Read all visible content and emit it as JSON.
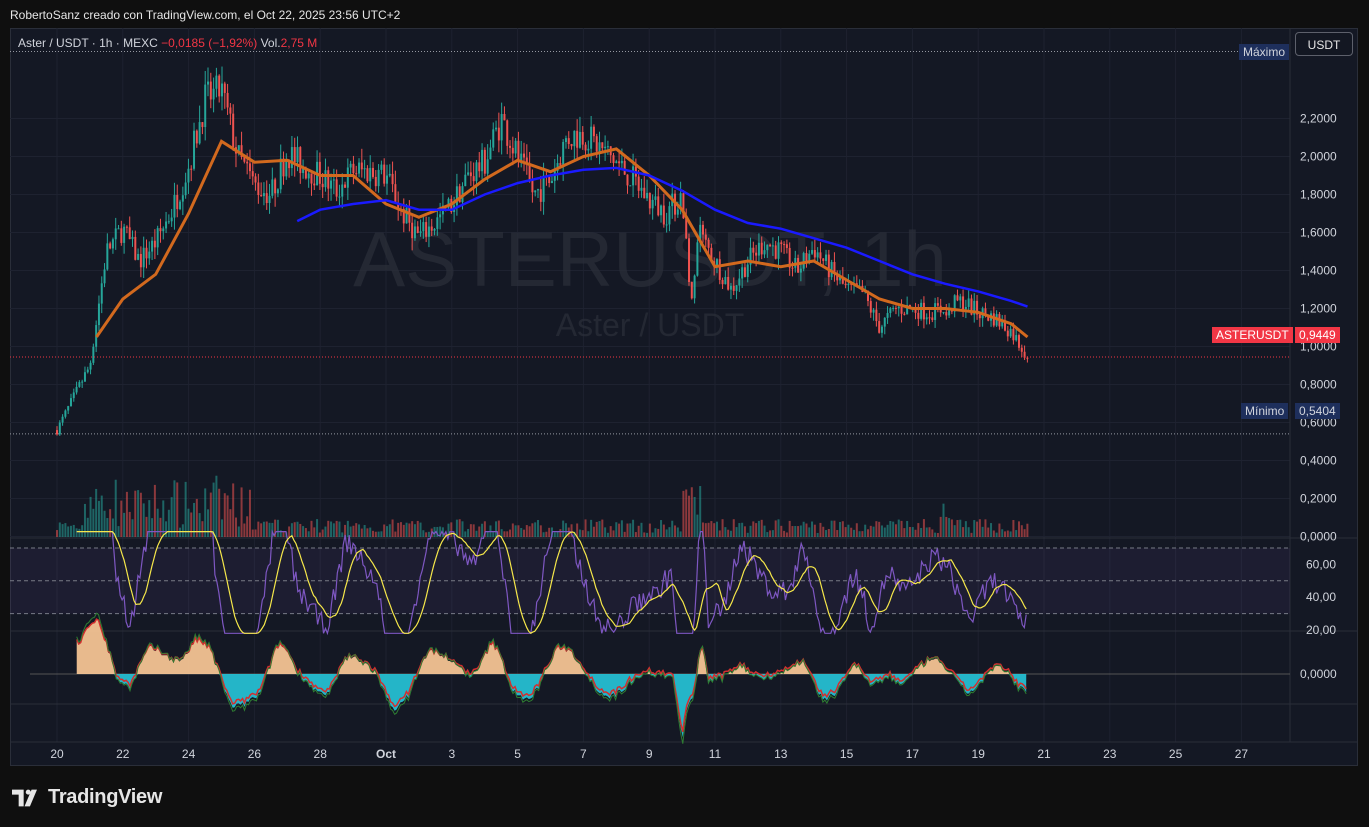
{
  "caption": "RobertoSanz creado con TradingView.com, el Oct 22, 2025 23:56 UTC+2",
  "legend": {
    "symbol": "Aster / USDT · 1h · MEXC",
    "change": "−0,0185 (−1,92%)",
    "vol_label": "Vol.",
    "vol_value": "2,75 M"
  },
  "watermark": {
    "symbol": "ASTERUSDT, 1h",
    "name": "Aster / USDT"
  },
  "currency_button": "USDT",
  "tags": {
    "max_label": "Máximo",
    "min_label": "Mínimo",
    "min_value": "0,5404",
    "symbol": "ASTERUSDT",
    "last_value": "0,9449"
  },
  "brand": "TradingView",
  "colors": {
    "up": "#26a69a",
    "down": "#ef5350",
    "ma_fast": "#d2691e",
    "ma_slow": "#1a1aff",
    "rsi": "#7e57c2",
    "rsi_ma": "#f5e74a",
    "background": "#141824"
  },
  "chart_data": {
    "type": "candlestick",
    "x_tick_labels": [
      "20",
      "22",
      "24",
      "26",
      "28",
      "Oct",
      "3",
      "5",
      "7",
      "9",
      "11",
      "13",
      "15",
      "17",
      "19",
      "21",
      "23",
      "25",
      "27"
    ],
    "y_ticks_price": [
      "2,2000",
      "2,0000",
      "1,8000",
      "1,6000",
      "1,4000",
      "1,2000",
      "1,0000",
      "0,8000",
      "0,6000",
      "0,4000",
      "0,2000",
      "0,0000"
    ],
    "y_ticks_rsi": [
      "60,00",
      "40,00",
      "20,00"
    ],
    "y_ticks_osc": [
      "0,0000"
    ],
    "ylim": [
      0,
      2.45
    ],
    "price_max": 2.42,
    "price_min": 0.5404,
    "last_price": 0.9449,
    "price_keypoints": [
      [
        0,
        0.56
      ],
      [
        1,
        0.9
      ],
      [
        1.5,
        1.5
      ],
      [
        2,
        1.62
      ],
      [
        2.5,
        1.45
      ],
      [
        3,
        1.55
      ],
      [
        3.5,
        1.72
      ],
      [
        4,
        1.95
      ],
      [
        4.5,
        2.3
      ],
      [
        5,
        2.35
      ],
      [
        5.5,
        2.0
      ],
      [
        6,
        1.85
      ],
      [
        6.5,
        1.8
      ],
      [
        7,
        2.02
      ],
      [
        7.5,
        1.95
      ],
      [
        8,
        1.9
      ],
      [
        8.5,
        1.82
      ],
      [
        9,
        1.93
      ],
      [
        9.5,
        1.92
      ],
      [
        10,
        1.9
      ],
      [
        10.5,
        1.7
      ],
      [
        11,
        1.58
      ],
      [
        11.5,
        1.65
      ],
      [
        12,
        1.75
      ],
      [
        12.5,
        1.9
      ],
      [
        13,
        1.97
      ],
      [
        13.5,
        2.2
      ],
      [
        14,
        2.0
      ],
      [
        14.5,
        1.8
      ],
      [
        15,
        1.88
      ],
      [
        15.5,
        2.1
      ],
      [
        16,
        2.12
      ],
      [
        16.5,
        2.05
      ],
      [
        17,
        1.97
      ],
      [
        17.5,
        1.88
      ],
      [
        18,
        1.77
      ],
      [
        18.5,
        1.7
      ],
      [
        19,
        1.8
      ],
      [
        19.3,
        1.2
      ],
      [
        19.5,
        1.6
      ],
      [
        20,
        1.45
      ],
      [
        20.5,
        1.3
      ],
      [
        21,
        1.45
      ],
      [
        21.5,
        1.55
      ],
      [
        22,
        1.5
      ],
      [
        22.5,
        1.4
      ],
      [
        23,
        1.52
      ],
      [
        23.5,
        1.4
      ],
      [
        24,
        1.3
      ],
      [
        24.5,
        1.28
      ],
      [
        25,
        1.1
      ],
      [
        25.5,
        1.2
      ],
      [
        26,
        1.2
      ],
      [
        26.5,
        1.18
      ],
      [
        27,
        1.2
      ],
      [
        27.5,
        1.24
      ],
      [
        28,
        1.18
      ],
      [
        28.5,
        1.15
      ],
      [
        29,
        1.08
      ],
      [
        29.5,
        0.95
      ]
    ],
    "ma_fast_keypoints": [
      [
        1.2,
        1.05
      ],
      [
        2,
        1.25
      ],
      [
        3,
        1.38
      ],
      [
        4,
        1.7
      ],
      [
        5,
        2.08
      ],
      [
        6,
        1.97
      ],
      [
        7,
        1.98
      ],
      [
        8,
        1.9
      ],
      [
        9,
        1.9
      ],
      [
        10,
        1.75
      ],
      [
        11,
        1.68
      ],
      [
        12,
        1.75
      ],
      [
        13,
        1.88
      ],
      [
        14,
        1.98
      ],
      [
        15,
        1.92
      ],
      [
        16,
        2.0
      ],
      [
        17,
        2.04
      ],
      [
        18,
        1.9
      ],
      [
        19,
        1.72
      ],
      [
        20,
        1.42
      ],
      [
        21,
        1.45
      ],
      [
        22,
        1.42
      ],
      [
        23,
        1.45
      ],
      [
        24,
        1.35
      ],
      [
        25,
        1.25
      ],
      [
        26,
        1.2
      ],
      [
        27,
        1.2
      ],
      [
        28,
        1.18
      ],
      [
        29,
        1.12
      ],
      [
        29.5,
        1.05
      ]
    ],
    "ma_slow_keypoints": [
      [
        7.3,
        1.66
      ],
      [
        8,
        1.72
      ],
      [
        9,
        1.75
      ],
      [
        10,
        1.77
      ],
      [
        11,
        1.72
      ],
      [
        12,
        1.72
      ],
      [
        13,
        1.8
      ],
      [
        14,
        1.86
      ],
      [
        15,
        1.9
      ],
      [
        16,
        1.93
      ],
      [
        17,
        1.94
      ],
      [
        18,
        1.9
      ],
      [
        19,
        1.82
      ],
      [
        20,
        1.72
      ],
      [
        21,
        1.65
      ],
      [
        22,
        1.62
      ],
      [
        23,
        1.57
      ],
      [
        24,
        1.52
      ],
      [
        25,
        1.45
      ],
      [
        26,
        1.38
      ],
      [
        27,
        1.33
      ],
      [
        28,
        1.29
      ],
      [
        29,
        1.24
      ],
      [
        29.5,
        1.21
      ]
    ],
    "rsi_levels": [
      70,
      50,
      30
    ]
  }
}
